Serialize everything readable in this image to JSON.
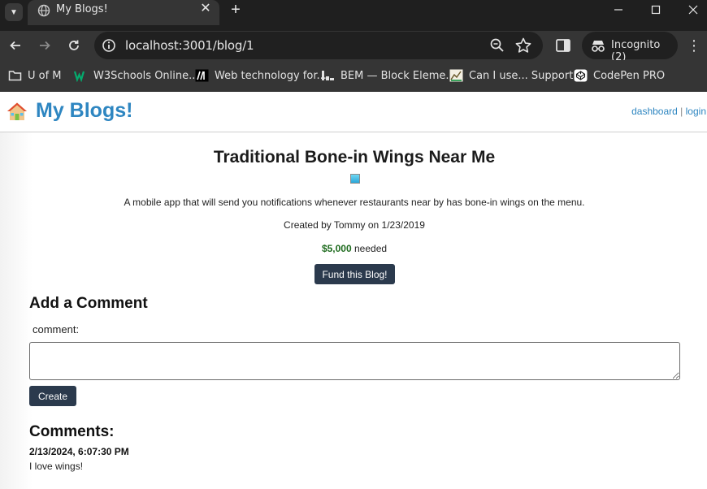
{
  "browser": {
    "tab_title": "My Blogs!",
    "url": "localhost:3001/blog/1",
    "incognito_label": "Incognito (2)",
    "bookmarks": [
      {
        "label": "U of M",
        "icon": "folder-icon"
      },
      {
        "label": "W3Schools Online...",
        "icon": "w3schools-icon"
      },
      {
        "label": "Web technology for...",
        "icon": "mdn-icon"
      },
      {
        "label": "BEM — Block Eleme...",
        "icon": "bem-icon"
      },
      {
        "label": "Can I use... Support...",
        "icon": "caniuse-icon"
      },
      {
        "label": "CodePen PRO",
        "icon": "codepen-icon"
      }
    ]
  },
  "site": {
    "brand_title": "My Blogs!",
    "brand_icon": "house-emoji",
    "nav": {
      "dashboard": "dashboard",
      "separator": "|",
      "login": "login"
    }
  },
  "post": {
    "title": "Traditional Bone-in Wings Near Me",
    "description": "A mobile app that will send you notifications whenever restaurants near by has bone-in wings on the menu.",
    "created_by": "Created by Tommy on 1/23/2019",
    "amount": "$5,000",
    "amount_suffix": "needed",
    "fund_button": "Fund this Blog!"
  },
  "comment_form": {
    "heading": "Add a Comment",
    "label": "comment:",
    "value": "",
    "submit": "Create"
  },
  "comments": {
    "heading": "Comments:",
    "items": [
      {
        "date": "2/13/2024, 6:07:30 PM",
        "text": "I love wings!"
      }
    ]
  },
  "colors": {
    "brand": "#2e86c1",
    "button": "#2b3a4d",
    "amount": "#1e6b1e"
  }
}
